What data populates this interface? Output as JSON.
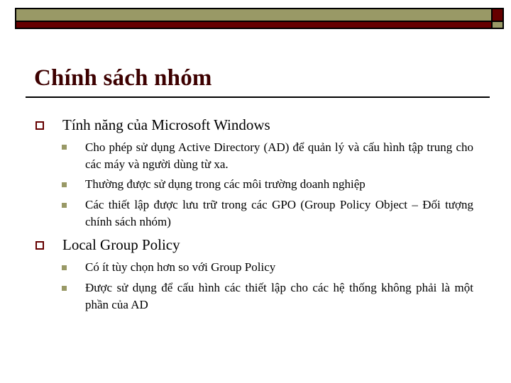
{
  "slide": {
    "title": "Chính sách nhóm",
    "colors": {
      "banner_olive": "#999966",
      "banner_maroon": "#660000",
      "title": "#3d0000",
      "bullet_l1_outline": "#660000",
      "bullet_l2_fill": "#999966"
    },
    "bullets": [
      {
        "icon": "hollow-square-bullet",
        "text": "Tính năng của Microsoft Windows",
        "sub": [
          {
            "icon": "filled-square-bullet",
            "text": "Cho phép sử dụng Active Directory (AD) để quản lý và cấu hình tập trung cho các máy và người dùng từ xa."
          },
          {
            "icon": "filled-square-bullet",
            "text": "Thường được sử dụng trong các môi trường doanh nghiệp"
          },
          {
            "icon": "filled-square-bullet",
            "text": "Các thiết lập được lưu trữ trong các GPO (Group Policy Object – Đối tượng chính sách nhóm)"
          }
        ]
      },
      {
        "icon": "hollow-square-bullet",
        "text": "Local Group Policy",
        "sub": [
          {
            "icon": "filled-square-bullet",
            "text": "Có ít tùy chọn hơn so với Group Policy"
          },
          {
            "icon": "filled-square-bullet",
            "text": "Được sử dụng để cấu hình các thiết lập cho các hệ thống không phải là một phần của AD"
          }
        ]
      }
    ]
  }
}
